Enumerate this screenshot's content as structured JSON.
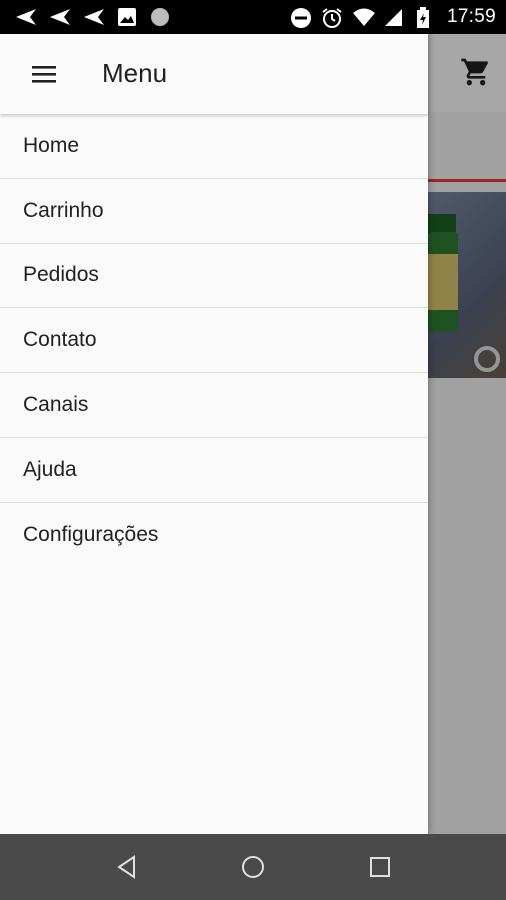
{
  "status_bar": {
    "time": "17:59",
    "left_icons": [
      "send-notification-icon",
      "send-notification-icon",
      "send-notification-icon",
      "image-icon",
      "circle-notification-icon"
    ],
    "right_icons": [
      "do-not-disturb-icon",
      "alarm-icon",
      "wifi-icon",
      "signal-icon",
      "battery-charging-icon"
    ]
  },
  "drawer": {
    "title": "Menu",
    "items": [
      {
        "label": "Home"
      },
      {
        "label": "Carrinho"
      },
      {
        "label": "Pedidos"
      },
      {
        "label": "Contato"
      },
      {
        "label": "Canais"
      },
      {
        "label": "Ajuda"
      },
      {
        "label": "Configurações"
      }
    ]
  },
  "colors": {
    "accent": "#e53935",
    "drawer_bg": "#fafafa",
    "nav_bar": "#4a4a4a"
  },
  "nav_bar": {
    "buttons": [
      "back-icon",
      "home-icon",
      "recents-icon"
    ]
  }
}
